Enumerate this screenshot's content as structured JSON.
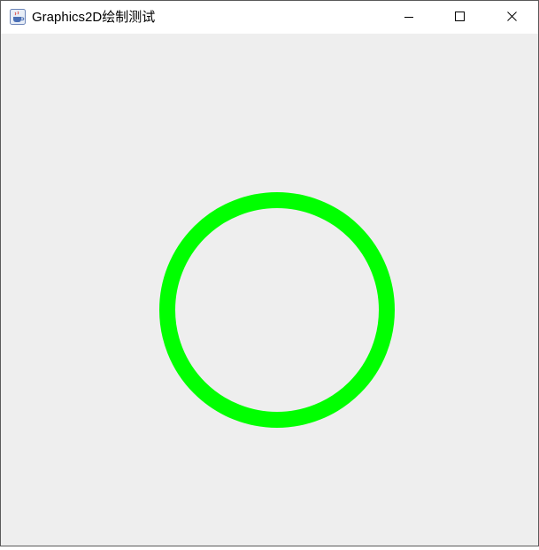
{
  "window": {
    "title": "Graphics2D绘制测试",
    "app_icon": "java-coffee-icon",
    "controls": [
      "minimize-icon",
      "maximize-icon",
      "close-icon"
    ]
  },
  "canvas": {
    "background": "#eeeeee",
    "shape": "circle-outline",
    "stroke_color": "#00ff00"
  }
}
